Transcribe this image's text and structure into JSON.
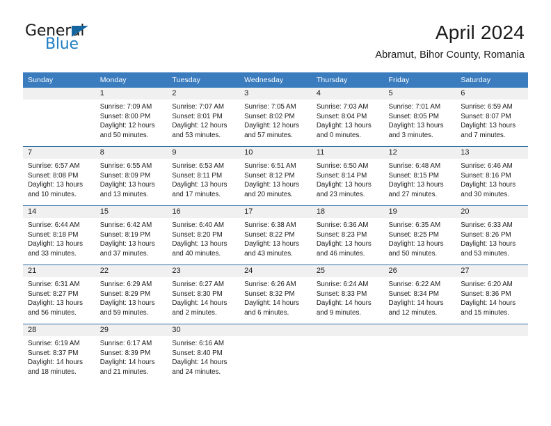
{
  "brand": {
    "name_part1": "General",
    "name_part2": "Blue",
    "triangle_color": "#15659f",
    "blue_color": "#1f7dc4"
  },
  "header": {
    "month_title": "April 2024",
    "location": "Abramut, Bihor County, Romania"
  },
  "theme": {
    "header_blue": "#3a7cbe",
    "rule_blue": "#2f6ca5",
    "daynum_band": "#f0f0f0"
  },
  "weekday_headers": [
    "Sunday",
    "Monday",
    "Tuesday",
    "Wednesday",
    "Thursday",
    "Friday",
    "Saturday"
  ],
  "labels": {
    "sunrise_prefix": "Sunrise:",
    "sunset_prefix": "Sunset:",
    "daylight_prefix": "Daylight:"
  },
  "weeks": [
    [
      {
        "day": "",
        "sunrise": "",
        "sunset": "",
        "daylight_line1": "",
        "daylight_line2": ""
      },
      {
        "day": "1",
        "sunrise": "Sunrise: 7:09 AM",
        "sunset": "Sunset: 8:00 PM",
        "daylight_line1": "Daylight: 12 hours",
        "daylight_line2": "and 50 minutes."
      },
      {
        "day": "2",
        "sunrise": "Sunrise: 7:07 AM",
        "sunset": "Sunset: 8:01 PM",
        "daylight_line1": "Daylight: 12 hours",
        "daylight_line2": "and 53 minutes."
      },
      {
        "day": "3",
        "sunrise": "Sunrise: 7:05 AM",
        "sunset": "Sunset: 8:02 PM",
        "daylight_line1": "Daylight: 12 hours",
        "daylight_line2": "and 57 minutes."
      },
      {
        "day": "4",
        "sunrise": "Sunrise: 7:03 AM",
        "sunset": "Sunset: 8:04 PM",
        "daylight_line1": "Daylight: 13 hours",
        "daylight_line2": "and 0 minutes."
      },
      {
        "day": "5",
        "sunrise": "Sunrise: 7:01 AM",
        "sunset": "Sunset: 8:05 PM",
        "daylight_line1": "Daylight: 13 hours",
        "daylight_line2": "and 3 minutes."
      },
      {
        "day": "6",
        "sunrise": "Sunrise: 6:59 AM",
        "sunset": "Sunset: 8:07 PM",
        "daylight_line1": "Daylight: 13 hours",
        "daylight_line2": "and 7 minutes."
      }
    ],
    [
      {
        "day": "7",
        "sunrise": "Sunrise: 6:57 AM",
        "sunset": "Sunset: 8:08 PM",
        "daylight_line1": "Daylight: 13 hours",
        "daylight_line2": "and 10 minutes."
      },
      {
        "day": "8",
        "sunrise": "Sunrise: 6:55 AM",
        "sunset": "Sunset: 8:09 PM",
        "daylight_line1": "Daylight: 13 hours",
        "daylight_line2": "and 13 minutes."
      },
      {
        "day": "9",
        "sunrise": "Sunrise: 6:53 AM",
        "sunset": "Sunset: 8:11 PM",
        "daylight_line1": "Daylight: 13 hours",
        "daylight_line2": "and 17 minutes."
      },
      {
        "day": "10",
        "sunrise": "Sunrise: 6:51 AM",
        "sunset": "Sunset: 8:12 PM",
        "daylight_line1": "Daylight: 13 hours",
        "daylight_line2": "and 20 minutes."
      },
      {
        "day": "11",
        "sunrise": "Sunrise: 6:50 AM",
        "sunset": "Sunset: 8:14 PM",
        "daylight_line1": "Daylight: 13 hours",
        "daylight_line2": "and 23 minutes."
      },
      {
        "day": "12",
        "sunrise": "Sunrise: 6:48 AM",
        "sunset": "Sunset: 8:15 PM",
        "daylight_line1": "Daylight: 13 hours",
        "daylight_line2": "and 27 minutes."
      },
      {
        "day": "13",
        "sunrise": "Sunrise: 6:46 AM",
        "sunset": "Sunset: 8:16 PM",
        "daylight_line1": "Daylight: 13 hours",
        "daylight_line2": "and 30 minutes."
      }
    ],
    [
      {
        "day": "14",
        "sunrise": "Sunrise: 6:44 AM",
        "sunset": "Sunset: 8:18 PM",
        "daylight_line1": "Daylight: 13 hours",
        "daylight_line2": "and 33 minutes."
      },
      {
        "day": "15",
        "sunrise": "Sunrise: 6:42 AM",
        "sunset": "Sunset: 8:19 PM",
        "daylight_line1": "Daylight: 13 hours",
        "daylight_line2": "and 37 minutes."
      },
      {
        "day": "16",
        "sunrise": "Sunrise: 6:40 AM",
        "sunset": "Sunset: 8:20 PM",
        "daylight_line1": "Daylight: 13 hours",
        "daylight_line2": "and 40 minutes."
      },
      {
        "day": "17",
        "sunrise": "Sunrise: 6:38 AM",
        "sunset": "Sunset: 8:22 PM",
        "daylight_line1": "Daylight: 13 hours",
        "daylight_line2": "and 43 minutes."
      },
      {
        "day": "18",
        "sunrise": "Sunrise: 6:36 AM",
        "sunset": "Sunset: 8:23 PM",
        "daylight_line1": "Daylight: 13 hours",
        "daylight_line2": "and 46 minutes."
      },
      {
        "day": "19",
        "sunrise": "Sunrise: 6:35 AM",
        "sunset": "Sunset: 8:25 PM",
        "daylight_line1": "Daylight: 13 hours",
        "daylight_line2": "and 50 minutes."
      },
      {
        "day": "20",
        "sunrise": "Sunrise: 6:33 AM",
        "sunset": "Sunset: 8:26 PM",
        "daylight_line1": "Daylight: 13 hours",
        "daylight_line2": "and 53 minutes."
      }
    ],
    [
      {
        "day": "21",
        "sunrise": "Sunrise: 6:31 AM",
        "sunset": "Sunset: 8:27 PM",
        "daylight_line1": "Daylight: 13 hours",
        "daylight_line2": "and 56 minutes."
      },
      {
        "day": "22",
        "sunrise": "Sunrise: 6:29 AM",
        "sunset": "Sunset: 8:29 PM",
        "daylight_line1": "Daylight: 13 hours",
        "daylight_line2": "and 59 minutes."
      },
      {
        "day": "23",
        "sunrise": "Sunrise: 6:27 AM",
        "sunset": "Sunset: 8:30 PM",
        "daylight_line1": "Daylight: 14 hours",
        "daylight_line2": "and 2 minutes."
      },
      {
        "day": "24",
        "sunrise": "Sunrise: 6:26 AM",
        "sunset": "Sunset: 8:32 PM",
        "daylight_line1": "Daylight: 14 hours",
        "daylight_line2": "and 6 minutes."
      },
      {
        "day": "25",
        "sunrise": "Sunrise: 6:24 AM",
        "sunset": "Sunset: 8:33 PM",
        "daylight_line1": "Daylight: 14 hours",
        "daylight_line2": "and 9 minutes."
      },
      {
        "day": "26",
        "sunrise": "Sunrise: 6:22 AM",
        "sunset": "Sunset: 8:34 PM",
        "daylight_line1": "Daylight: 14 hours",
        "daylight_line2": "and 12 minutes."
      },
      {
        "day": "27",
        "sunrise": "Sunrise: 6:20 AM",
        "sunset": "Sunset: 8:36 PM",
        "daylight_line1": "Daylight: 14 hours",
        "daylight_line2": "and 15 minutes."
      }
    ],
    [
      {
        "day": "28",
        "sunrise": "Sunrise: 6:19 AM",
        "sunset": "Sunset: 8:37 PM",
        "daylight_line1": "Daylight: 14 hours",
        "daylight_line2": "and 18 minutes."
      },
      {
        "day": "29",
        "sunrise": "Sunrise: 6:17 AM",
        "sunset": "Sunset: 8:39 PM",
        "daylight_line1": "Daylight: 14 hours",
        "daylight_line2": "and 21 minutes."
      },
      {
        "day": "30",
        "sunrise": "Sunrise: 6:16 AM",
        "sunset": "Sunset: 8:40 PM",
        "daylight_line1": "Daylight: 14 hours",
        "daylight_line2": "and 24 minutes."
      },
      {
        "day": "",
        "sunrise": "",
        "sunset": "",
        "daylight_line1": "",
        "daylight_line2": ""
      },
      {
        "day": "",
        "sunrise": "",
        "sunset": "",
        "daylight_line1": "",
        "daylight_line2": ""
      },
      {
        "day": "",
        "sunrise": "",
        "sunset": "",
        "daylight_line1": "",
        "daylight_line2": ""
      },
      {
        "day": "",
        "sunrise": "",
        "sunset": "",
        "daylight_line1": "",
        "daylight_line2": ""
      }
    ]
  ]
}
